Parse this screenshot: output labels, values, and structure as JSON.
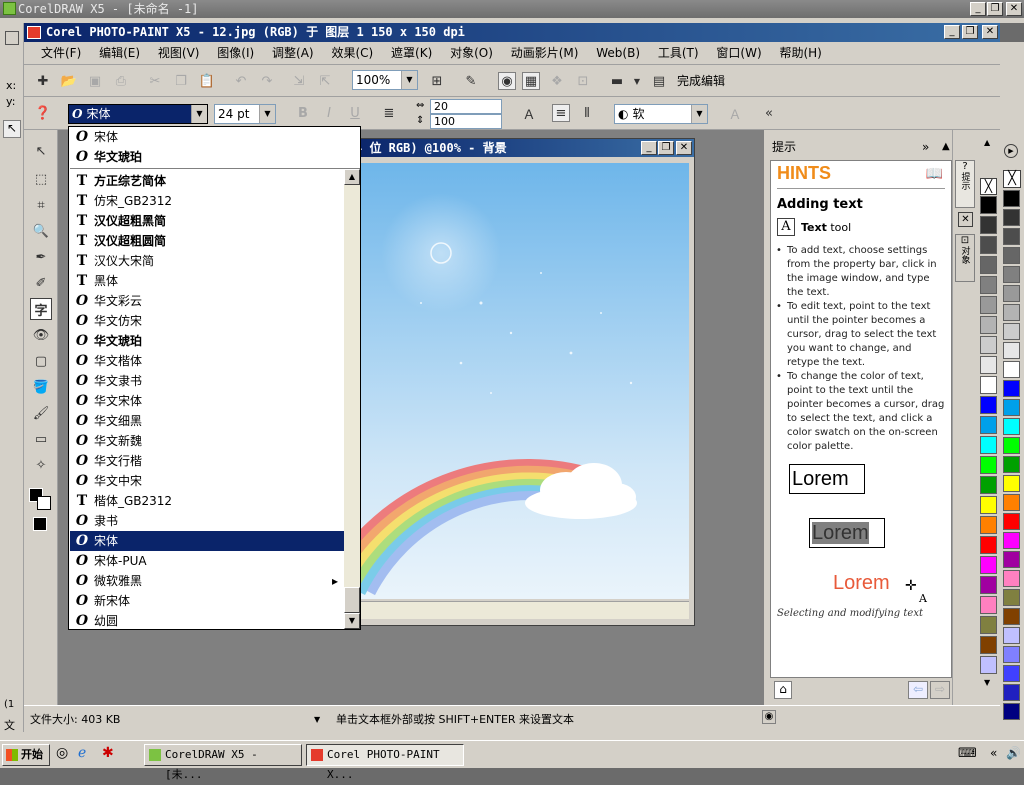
{
  "outer_window": {
    "title": "CorelDRAW X5 - [未命名 -1]",
    "left_labels": [
      "x:",
      "y:"
    ],
    "bottom_labels": [
      "(1",
      "文"
    ]
  },
  "pp_window": {
    "title": "Corel PHOTO-PAINT X5 - 12.jpg (RGB) 于 图层 1 150 x 150 dpi"
  },
  "menu": [
    "文件(F)",
    "编辑(E)",
    "视图(V)",
    "图像(I)",
    "调整(A)",
    "效果(C)",
    "遮罩(K)",
    "对象(O)",
    "动画影片(M)",
    "Web(B)",
    "工具(T)",
    "窗口(W)",
    "帮助(H)"
  ],
  "toolbar": {
    "zoom_value": "100%",
    "finish_edit_label": "完成编辑"
  },
  "property_bar": {
    "font_name": "宋体",
    "font_size": "24 pt",
    "char_spacing": "20",
    "line_spacing": "100",
    "antialias": "软"
  },
  "image_window": {
    "title": "4 位 RGB) @100% - 背景"
  },
  "font_list": {
    "recent": [
      {
        "name": "宋体",
        "icon": "opentype",
        "bold": false
      },
      {
        "name": "华文琥珀",
        "icon": "opentype",
        "bold": true
      }
    ],
    "all": [
      {
        "name": "方正综艺简体",
        "icon": "truetype",
        "bold": true
      },
      {
        "name": "仿宋_GB2312",
        "icon": "truetype",
        "bold": false
      },
      {
        "name": "汉仪超粗黑简",
        "icon": "truetype",
        "bold": true
      },
      {
        "name": "汉仪超粗圆简",
        "icon": "truetype",
        "bold": true
      },
      {
        "name": "汉仪大宋简",
        "icon": "truetype",
        "bold": false
      },
      {
        "name": "黑体",
        "icon": "truetype",
        "bold": false
      },
      {
        "name": "华文彩云",
        "icon": "opentype",
        "bold": false
      },
      {
        "name": "华文仿宋",
        "icon": "opentype",
        "bold": false
      },
      {
        "name": "华文琥珀",
        "icon": "opentype",
        "bold": true
      },
      {
        "name": "华文楷体",
        "icon": "opentype",
        "bold": false
      },
      {
        "name": "华文隶书",
        "icon": "opentype",
        "bold": false
      },
      {
        "name": "华文宋体",
        "icon": "opentype",
        "bold": false
      },
      {
        "name": "华文细黑",
        "icon": "opentype",
        "bold": false
      },
      {
        "name": "华文新魏",
        "icon": "opentype",
        "bold": false
      },
      {
        "name": "华文行楷",
        "icon": "opentype",
        "bold": false
      },
      {
        "name": "华文中宋",
        "icon": "opentype",
        "bold": false
      },
      {
        "name": "楷体_GB2312",
        "icon": "truetype",
        "bold": false
      },
      {
        "name": "隶书",
        "icon": "opentype",
        "bold": false
      },
      {
        "name": "宋体",
        "icon": "opentype",
        "bold": false,
        "selected": true
      },
      {
        "name": "宋体-PUA",
        "icon": "opentype",
        "bold": false
      },
      {
        "name": "微软雅黑",
        "icon": "opentype",
        "bold": false,
        "submenu": true
      },
      {
        "name": "新宋体",
        "icon": "opentype",
        "bold": false
      },
      {
        "name": "幼圆",
        "icon": "opentype",
        "bold": false
      }
    ]
  },
  "hints": {
    "panel_title": "提示",
    "header": "HINTS",
    "section_title": "Adding text",
    "tool_name": "Text",
    "tool_suffix": "tool",
    "bullets": [
      "To add text, choose settings from the property bar, click in the image window, and type the text.",
      "To edit text, point to the text until the pointer becomes a cursor, drag to select the text you want to change, and retype the text.",
      "To change the color of text, point to the text until the pointer becomes a cursor, drag to select the text, and click a color swatch on the on-screen color palette."
    ],
    "sample_word": "Lorem",
    "sample_a_letter": "A",
    "caption": "Selecting and modifying text",
    "tab_labels": [
      "提示",
      "对象"
    ]
  },
  "palette_colors": [
    "#000000",
    "#333333",
    "#4d4d4d",
    "#666666",
    "#808080",
    "#999999",
    "#b3b3b3",
    "#cccccc",
    "#e6e6e6",
    "#ffffff",
    "#0000ff",
    "#00a0e9",
    "#00ffff",
    "#00ff00",
    "#00a000",
    "#ffff00",
    "#ff8000",
    "#ff0000",
    "#ff00ff",
    "#a000a0",
    "#ff80c0",
    "#808040",
    "#804000",
    "#c0c0ff",
    "#8080ff",
    "#4040ff",
    "#2020c0",
    "#000080"
  ],
  "status": {
    "file_size": "文件大小: 403 KB",
    "hint": "单击文本框外部或按 SHIFT+ENTER 来设置文本"
  },
  "taskbar": {
    "start": "开始",
    "tasks": [
      "CorelDRAW X5 - [未...",
      "Corel PHOTO-PAINT X..."
    ]
  }
}
